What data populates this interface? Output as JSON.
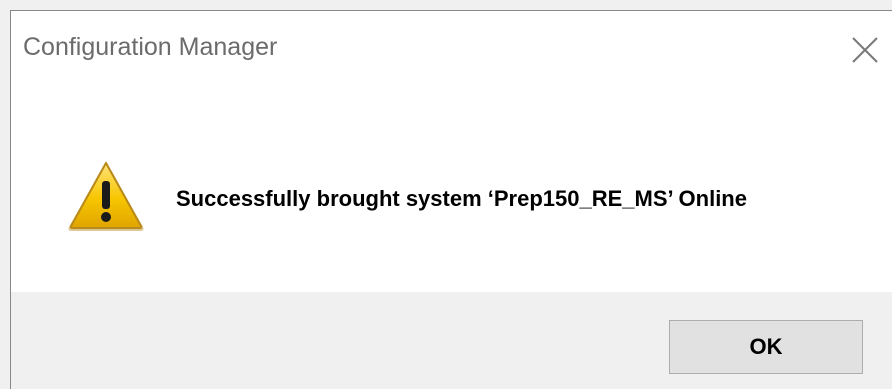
{
  "dialog": {
    "title": "Configuration Manager",
    "message": "Successfully brought system ‘Prep150_RE_MS’ Online",
    "ok_label": "OK",
    "icon": "warning-icon",
    "close_icon": "close-icon"
  },
  "colors": {
    "title_text": "#6b6b6b",
    "content_bg": "#ffffff",
    "footer_bg": "#f0f0f0",
    "button_bg": "#e1e1e1",
    "button_border": "#adadad",
    "warning_yellow": "#f5c400"
  }
}
